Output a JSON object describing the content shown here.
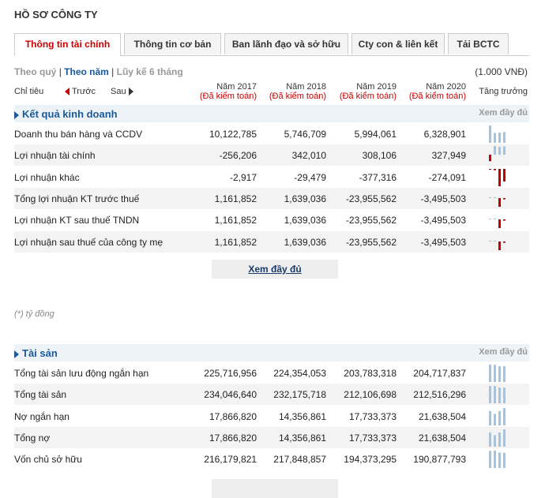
{
  "page_title": "HỒ SƠ CÔNG TY",
  "tabs": [
    {
      "label": "Thông tin tài chính"
    },
    {
      "label": "Thông tin cơ bản"
    },
    {
      "label": "Ban lãnh đạo và sở hữu"
    },
    {
      "label": "Cty con & liên kết"
    },
    {
      "label": "Tải BCTC"
    }
  ],
  "period": {
    "quarter": "Theo quý",
    "year": "Theo năm",
    "cumulative": "Lũy kế 6 tháng",
    "sep": "|"
  },
  "unit": "(1.000 VNĐ)",
  "header": {
    "criteria": "Chỉ tiêu",
    "prev": "Trước",
    "next": "Sau",
    "growth": "Tăng trưởng",
    "years": [
      {
        "year": "Năm 2017",
        "audit": "(Đã kiểm toán)"
      },
      {
        "year": "Năm 2018",
        "audit": "(Đã kiểm toán)"
      },
      {
        "year": "Năm 2019",
        "audit": "(Đã kiểm toán)"
      },
      {
        "year": "Năm 2020",
        "audit": "(Đã kiểm toán)"
      }
    ]
  },
  "sections": [
    {
      "title": "Kết quả kinh doanh",
      "more": "Xem đầy đủ",
      "rows": [
        {
          "label": "Doanh thu bán hàng và CCDV",
          "values": [
            "10,122,785",
            "5,746,709",
            "5,994,061",
            "6,328,901"
          ],
          "spark": [
            10122785,
            5746709,
            5994061,
            6328901
          ]
        },
        {
          "label": "Lợi nhuận tài chính",
          "values": [
            "-256,206",
            "342,010",
            "308,106",
            "327,949"
          ],
          "spark": [
            -256206,
            342010,
            308106,
            327949
          ]
        },
        {
          "label": "Lợi nhuận khác",
          "values": [
            "-2,917",
            "-29,479",
            "-377,316",
            "-274,091"
          ],
          "spark": [
            -2917,
            -29479,
            -377316,
            -274091
          ]
        },
        {
          "label": "Tổng lợi nhuận KT trước thuế",
          "values": [
            "1,161,852",
            "1,639,036",
            "-23,955,562",
            "-3,495,503"
          ],
          "spark": [
            1161852,
            1639036,
            -23955562,
            -3495503
          ]
        },
        {
          "label": "Lợi nhuận KT sau thuế TNDN",
          "values": [
            "1,161,852",
            "1,639,036",
            "-23,955,562",
            "-3,495,503"
          ],
          "spark": [
            1161852,
            1639036,
            -23955562,
            -3495503
          ]
        },
        {
          "label": "Lợi nhuận sau thuế của công ty mẹ",
          "values": [
            "1,161,852",
            "1,639,036",
            "-23,955,562",
            "-3,495,503"
          ],
          "spark": [
            1161852,
            1639036,
            -23955562,
            -3495503
          ]
        }
      ]
    },
    {
      "title": "Tài sản",
      "more": "Xem đầy đủ",
      "rows": [
        {
          "label": "Tổng tài sản lưu động ngắn hạn",
          "values": [
            "225,716,956",
            "224,354,053",
            "203,783,318",
            "204,717,837"
          ],
          "spark": [
            225716956,
            224354053,
            203783318,
            204717837
          ]
        },
        {
          "label": "Tổng tài sản",
          "values": [
            "234,046,640",
            "232,175,718",
            "212,106,698",
            "212,516,296"
          ],
          "spark": [
            234046640,
            232175718,
            212106698,
            212516296
          ]
        },
        {
          "label": "Nợ ngắn hạn",
          "values": [
            "17,866,820",
            "14,356,861",
            "17,733,373",
            "21,638,504"
          ],
          "spark": [
            17866820,
            14356861,
            17733373,
            21638504
          ]
        },
        {
          "label": "Tổng nợ",
          "values": [
            "17,866,820",
            "14,356,861",
            "17,733,373",
            "21,638,504"
          ],
          "spark": [
            17866820,
            14356861,
            17733373,
            21638504
          ]
        },
        {
          "label": "Vốn chủ sở hữu",
          "values": [
            "216,179,821",
            "217,848,857",
            "194,373,295",
            "190,877,793"
          ],
          "spark": [
            216179821,
            217848857,
            194373295,
            190877793
          ]
        }
      ]
    }
  ],
  "view_full_button": "Xem đầy đủ",
  "note": "(*) tỷ đồng",
  "colors": {
    "positive_bar": "#9ec5e8",
    "negative_bar": "#c00000",
    "accent": "#c00000",
    "link": "#1a5a9a"
  }
}
